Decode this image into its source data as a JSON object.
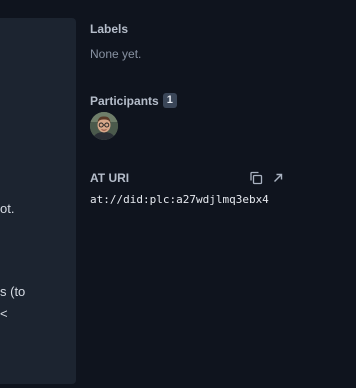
{
  "content": {
    "fragments": [
      "ot.",
      "s (to",
      "<"
    ]
  },
  "sidebar": {
    "labels": {
      "title": "Labels",
      "empty_text": "None yet."
    },
    "participants": {
      "title": "Participants",
      "count": "1"
    },
    "at_uri": {
      "title": "AT URI",
      "value": "at://did:plc:a27wdjlmq3ebx4",
      "copy_icon": "copy-icon",
      "open_icon": "external-link-icon"
    }
  },
  "colors": {
    "background": "#0f141e",
    "panel": "#1c2430",
    "badge": "#3a4658"
  }
}
